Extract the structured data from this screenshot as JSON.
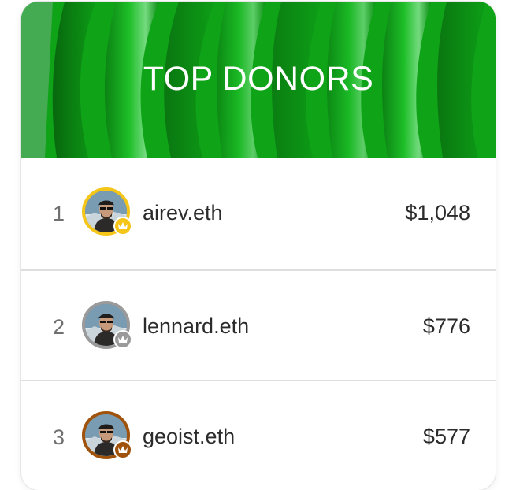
{
  "header": {
    "title": "TOP DONORS",
    "accent_color": "#0ea517"
  },
  "donors": [
    {
      "rank": "1",
      "name": "airev.eth",
      "amount": "$1,048",
      "badge_color": "#f5c518",
      "badge_icon": "crown-icon"
    },
    {
      "rank": "2",
      "name": "lennard.eth",
      "amount": "$776",
      "badge_color": "#9a9a9a",
      "badge_icon": "crown-icon"
    },
    {
      "rank": "3",
      "name": "geoist.eth",
      "amount": "$577",
      "badge_color": "#a0520a",
      "badge_icon": "crown-icon"
    }
  ]
}
